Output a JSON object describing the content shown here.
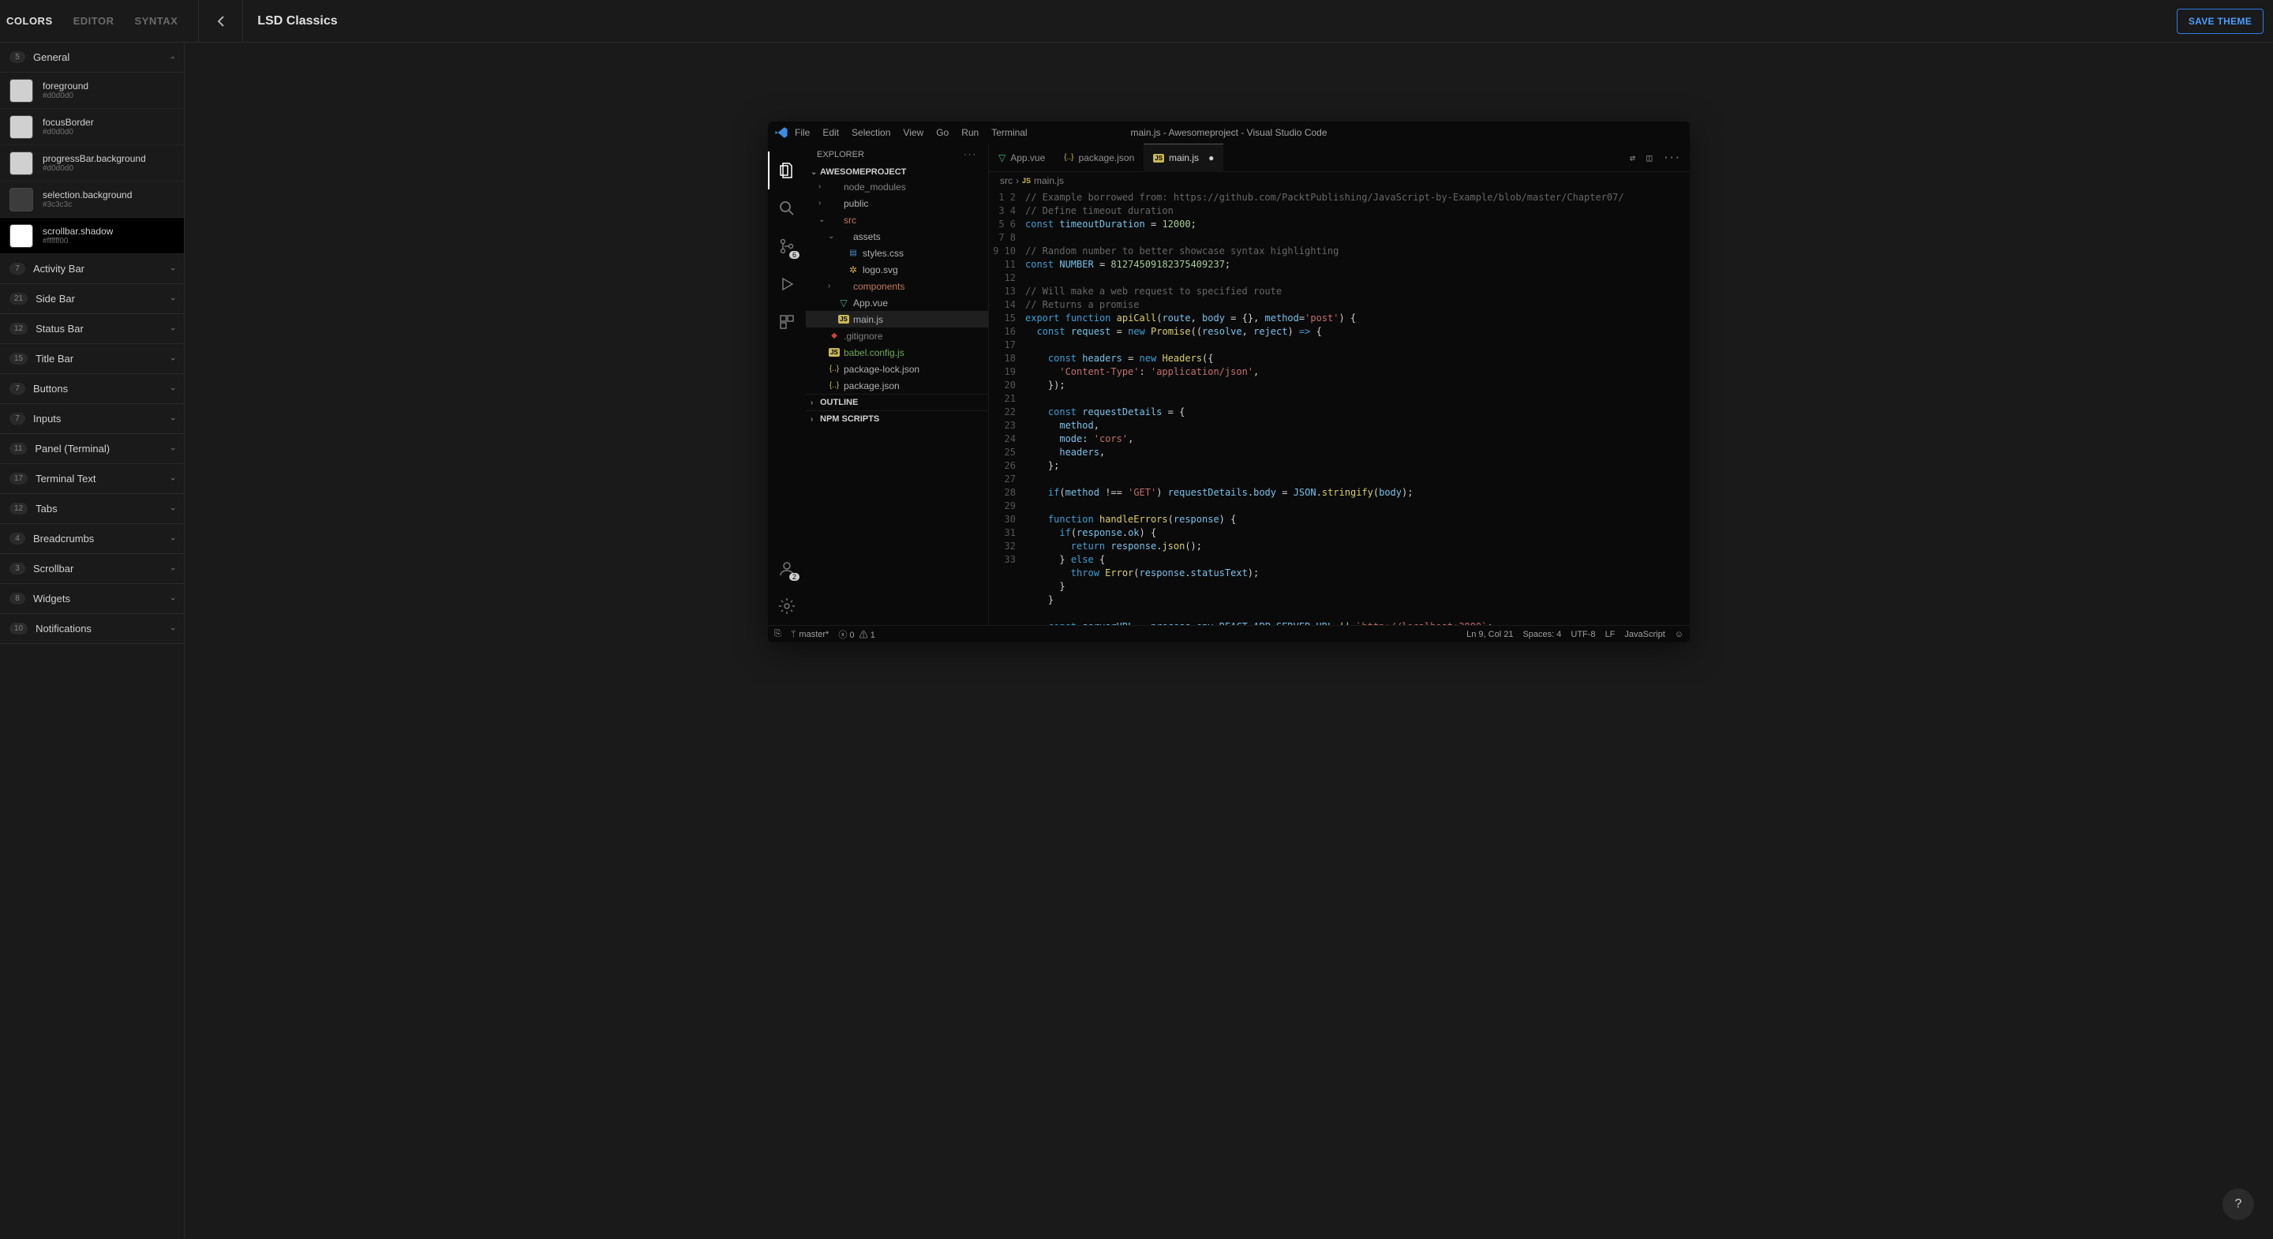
{
  "topbar": {
    "tabs": [
      "COLORS",
      "EDITOR",
      "SYNTAX"
    ],
    "active_tab": 0,
    "theme_title": "LSD Classics",
    "save_label": "SAVE THEME"
  },
  "sections": [
    {
      "count": "5",
      "title": "General",
      "expanded": true
    },
    {
      "count": "7",
      "title": "Activity Bar",
      "expanded": false
    },
    {
      "count": "21",
      "title": "Side Bar",
      "expanded": false
    },
    {
      "count": "12",
      "title": "Status Bar",
      "expanded": false
    },
    {
      "count": "15",
      "title": "Title Bar",
      "expanded": false
    },
    {
      "count": "7",
      "title": "Buttons",
      "expanded": false
    },
    {
      "count": "7",
      "title": "Inputs",
      "expanded": false
    },
    {
      "count": "11",
      "title": "Panel (Terminal)",
      "expanded": false
    },
    {
      "count": "17",
      "title": "Terminal Text",
      "expanded": false
    },
    {
      "count": "12",
      "title": "Tabs",
      "expanded": false
    },
    {
      "count": "4",
      "title": "Breadcrumbs",
      "expanded": false
    },
    {
      "count": "3",
      "title": "Scrollbar",
      "expanded": false
    },
    {
      "count": "8",
      "title": "Widgets",
      "expanded": false
    },
    {
      "count": "10",
      "title": "Notifications",
      "expanded": false
    }
  ],
  "colors": [
    {
      "name": "foreground",
      "hex": "#d0d0d0",
      "swatch": "#d0d0d0",
      "selected": false
    },
    {
      "name": "focusBorder",
      "hex": "#d0d0d0",
      "swatch": "#d0d0d0",
      "selected": false
    },
    {
      "name": "progressBar.background",
      "hex": "#d0d0d0",
      "swatch": "#d0d0d0",
      "selected": false
    },
    {
      "name": "selection.background",
      "hex": "#3c3c3c",
      "swatch": "#3c3c3c",
      "selected": false
    },
    {
      "name": "scrollbar.shadow",
      "hex": "#ffffff00",
      "swatch": "#ffffff",
      "selected": true
    }
  ],
  "vscode": {
    "menu": [
      "File",
      "Edit",
      "Selection",
      "View",
      "Go",
      "Run",
      "Terminal"
    ],
    "window_title": "main.js - Awesomeproject - Visual Studio Code",
    "explorer_label": "EXPLORER",
    "project_name": "AWESOMEPROJECT",
    "outline_label": "OUTLINE",
    "npm_label": "NPM SCRIPTS",
    "badges": {
      "scm": "6",
      "account": "2"
    },
    "tree": [
      {
        "indent": 1,
        "name": "node_modules",
        "chev": "›",
        "icon": "",
        "color": "#808080"
      },
      {
        "indent": 1,
        "name": "public",
        "chev": "›",
        "icon": "",
        "color": "#b0b0b0"
      },
      {
        "indent": 1,
        "name": "src",
        "chev": "⌄",
        "icon": "",
        "color": "#c27a5a"
      },
      {
        "indent": 2,
        "name": "assets",
        "chev": "⌄",
        "icon": "",
        "color": "#b0b0b0"
      },
      {
        "indent": 3,
        "name": "styles.css",
        "chev": "",
        "icon": "🟦",
        "color": "#b0b0b0"
      },
      {
        "indent": 3,
        "name": "logo.svg",
        "chev": "",
        "icon": "🟡",
        "color": "#b0b0b0"
      },
      {
        "indent": 2,
        "name": "components",
        "chev": "›",
        "icon": "",
        "color": "#c27a5a"
      },
      {
        "indent": 2,
        "name": "App.vue",
        "chev": "",
        "icon": "▽",
        "color": "#b0b0b0"
      },
      {
        "indent": 2,
        "name": "main.js",
        "chev": "",
        "icon": "JS",
        "color": "#b0b0b0",
        "active": true
      },
      {
        "indent": 1,
        "name": ".gitignore",
        "chev": "",
        "icon": "◆",
        "color": "#808080"
      },
      {
        "indent": 1,
        "name": "babel.config.js",
        "chev": "",
        "icon": "JS",
        "color": "#6fa85a"
      },
      {
        "indent": 1,
        "name": "package-lock.json",
        "chev": "",
        "icon": "{}",
        "color": "#b0b0b0"
      },
      {
        "indent": 1,
        "name": "package.json",
        "chev": "",
        "icon": "{}",
        "color": "#b0b0b0"
      }
    ],
    "tabs": [
      {
        "label": "App.vue",
        "icon": "▽",
        "icon_color": "#3fb37f",
        "active": false
      },
      {
        "label": "package.json",
        "icon": "{}",
        "icon_color": "#c9b857",
        "active": false
      },
      {
        "label": "main.js",
        "icon": "JS",
        "icon_color": "#c9b857",
        "active": true,
        "dirty": true
      }
    ],
    "breadcrumb": [
      "src",
      "main.js"
    ],
    "status": {
      "branch": "master*",
      "errors": "0",
      "warnings": "1",
      "ln_col": "Ln 9, Col 21",
      "spaces": "Spaces: 4",
      "encoding": "UTF-8",
      "eol": "LF",
      "lang": "JavaScript"
    },
    "code_lines": 33
  },
  "help_label": "?"
}
